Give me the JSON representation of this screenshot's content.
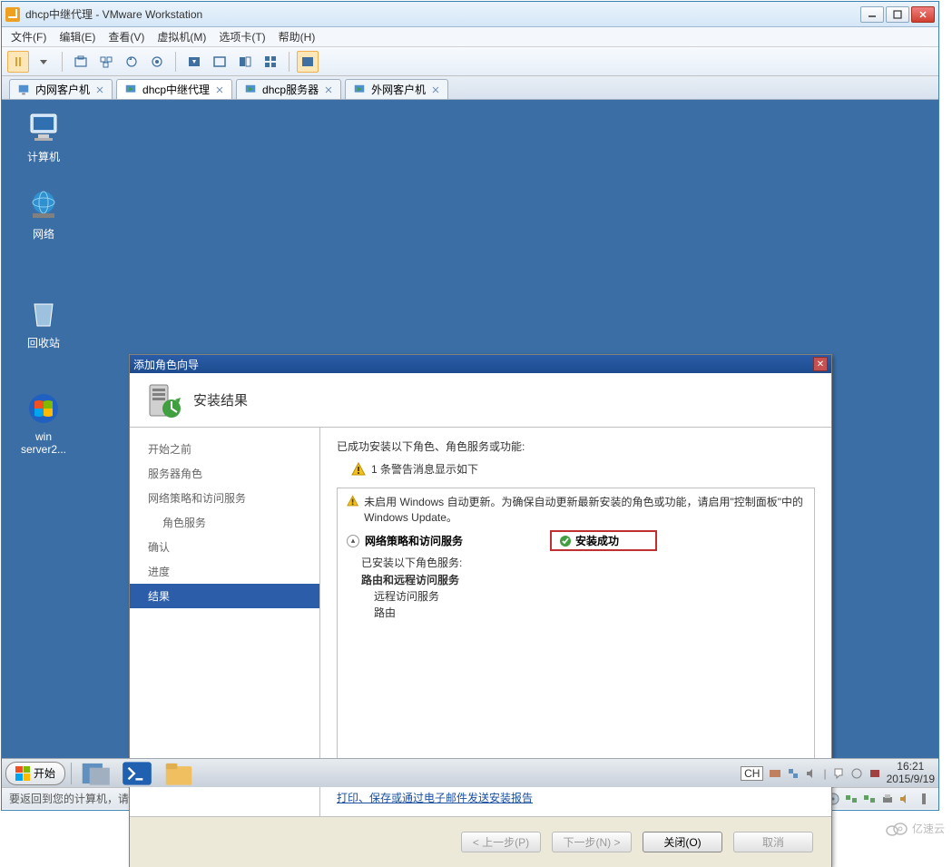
{
  "vmware": {
    "title": "dhcp中继代理 - VMware Workstation",
    "menu": {
      "file": "文件(F)",
      "edit": "编辑(E)",
      "view": "查看(V)",
      "vm": "虚拟机(M)",
      "tabs": "选项卡(T)",
      "help": "帮助(H)"
    },
    "tabs": [
      {
        "label": "内网客户机",
        "active": false
      },
      {
        "label": "dhcp中继代理",
        "active": true
      },
      {
        "label": "dhcp服务器",
        "active": false
      },
      {
        "label": "外网客户机",
        "active": false
      }
    ],
    "status": "要返回到您的计算机，请将鼠标指针从虚拟机中移出或按 Ctrl+Alt。"
  },
  "desktop": {
    "icons": {
      "computer": "计算机",
      "network": "网络",
      "recycle": "回收站",
      "winserver": "win\nserver2..."
    }
  },
  "wizard": {
    "title": "添加角色向导",
    "heading": "安装结果",
    "nav": {
      "before": "开始之前",
      "serverRoles": "服务器角色",
      "npas": "网络策略和访问服务",
      "roleService": "角色服务",
      "confirm": "确认",
      "progress": "进度",
      "result": "结果"
    },
    "main": {
      "successLine": "已成功安装以下角色、角色服务或功能:",
      "warningCount": "1 条警告消息显示如下",
      "updateWarn": "未启用 Windows 自动更新。为确保自动更新最新安装的角色或功能，请启用\"控制面板\"中的 Windows Update。",
      "roleLabel": "网络策略和访问服务",
      "installSuccess": "安装成功",
      "installedHeader": "已安装以下角色服务:",
      "routing": "路由和远程访问服务",
      "ras": "远程访问服务",
      "route": "路由",
      "reportLink": "打印、保存或通过电子邮件发送安装报告"
    },
    "buttons": {
      "prev": "< 上一步(P)",
      "next": "下一步(N) >",
      "close": "关闭(O)",
      "cancel": "取消"
    }
  },
  "taskbar": {
    "start": "开始",
    "ime": "CH",
    "time": "16:21",
    "date": "2015/9/19"
  },
  "watermark": "亿速云"
}
